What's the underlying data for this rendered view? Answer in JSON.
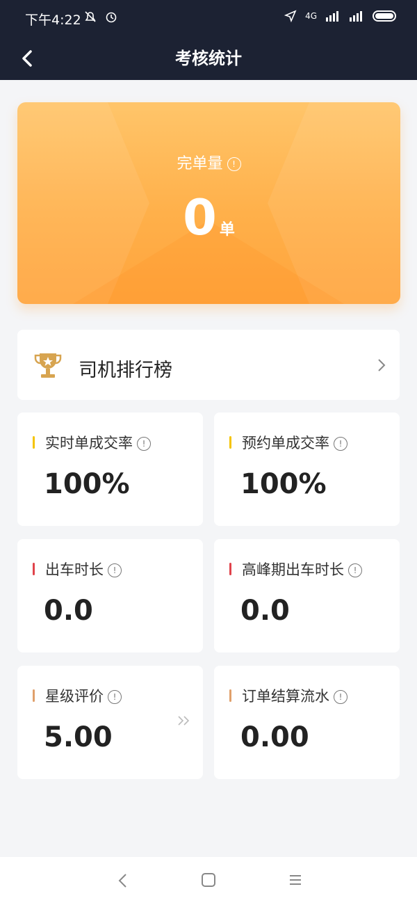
{
  "status_bar": {
    "time": "下午4:22",
    "network": "4G"
  },
  "nav": {
    "title": "考核统计"
  },
  "summary": {
    "label": "完单量",
    "value": "0",
    "unit": "单"
  },
  "ranking": {
    "label": "司机排行榜"
  },
  "stats": [
    {
      "title": "实时单成交率",
      "value": "100%",
      "color": "#f5c400"
    },
    {
      "title": "预约单成交率",
      "value": "100%",
      "color": "#f5c400"
    },
    {
      "title": "出车时长",
      "value": "0.0",
      "color": "#e0434b"
    },
    {
      "title": "高峰期出车时长",
      "value": "0.0",
      "color": "#e0434b"
    },
    {
      "title": "星级评价",
      "value": "5.00",
      "color": "#e0a06b"
    },
    {
      "title": "订单结算流水",
      "value": "0.00",
      "color": "#e0a06b"
    }
  ],
  "icons": {
    "back": "chevron-left-icon",
    "trophy": "trophy-icon",
    "info": "info-icon",
    "rank_arrow": "chevron-right-icon"
  }
}
